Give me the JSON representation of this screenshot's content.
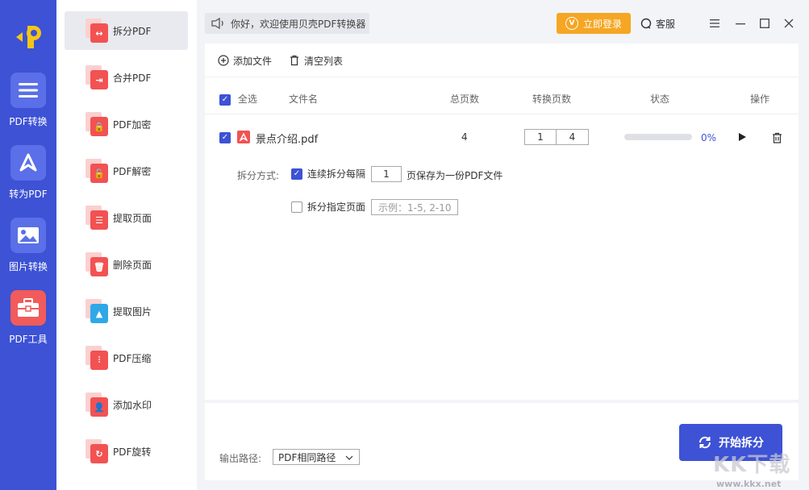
{
  "rail": {
    "items": [
      {
        "label": "PDF转换",
        "icon": "list-icon"
      },
      {
        "label": "转为PDF",
        "icon": "pdf-symbol-icon"
      },
      {
        "label": "图片转换",
        "icon": "image-icon"
      },
      {
        "label": "PDF工具",
        "icon": "toolbox-icon"
      }
    ]
  },
  "tools": {
    "items": [
      {
        "label": "拆分PDF",
        "glyph": "↔"
      },
      {
        "label": "合并PDF",
        "glyph": "⇥"
      },
      {
        "label": "PDF加密",
        "glyph": "🔒"
      },
      {
        "label": "PDF解密",
        "glyph": "🔓"
      },
      {
        "label": "提取页面",
        "glyph": "☰"
      },
      {
        "label": "删除页面",
        "glyph": "🗑"
      },
      {
        "label": "提取图片",
        "glyph": "▲"
      },
      {
        "label": "PDF压缩",
        "glyph": "⫶"
      },
      {
        "label": "添加水印",
        "glyph": "👤"
      },
      {
        "label": "PDF旋转",
        "glyph": "↻"
      }
    ]
  },
  "topbar": {
    "notice": "你好，欢迎使用贝壳PDF转换器",
    "login": "立即登录",
    "login_badge": "V",
    "service": "客服"
  },
  "toolbar": {
    "add": "添加文件",
    "clear": "清空列表"
  },
  "list": {
    "headers": {
      "select_all": "全选",
      "filename": "文件名",
      "total_pages": "总页数",
      "convert_pages": "转换页数",
      "status": "状态",
      "actions": "操作"
    },
    "file": {
      "name": "景点介绍.pdf",
      "total": "4",
      "from": "1",
      "to": "4",
      "progress": "0%",
      "progress_value": 0
    },
    "split": {
      "label": "拆分方式:",
      "option1_prefix": "连续拆分每隔",
      "option1_value": "1",
      "option1_suffix": "页保存为一份PDF文件",
      "option2": "拆分指定页面",
      "option2_placeholder": "示例：1-5, 2-10"
    }
  },
  "footer": {
    "output_label": "输出路径:",
    "output_value": "PDF相同路径",
    "start": "开始拆分"
  },
  "watermark": {
    "text": "KK下载",
    "url": "www.kkx.net"
  },
  "colors": {
    "primary": "#3d52d5",
    "accent_red": "#f25252",
    "login_orange": "#f5a623"
  }
}
